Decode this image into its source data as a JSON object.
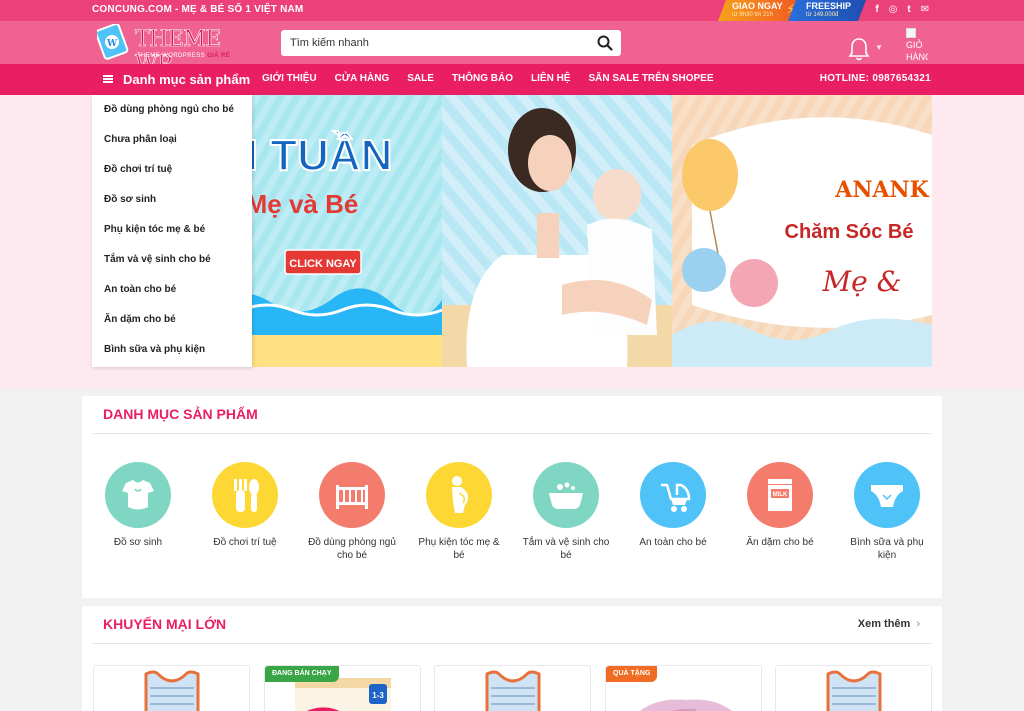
{
  "topbar": {
    "tagline": "CONCUNG.COM - MẸ & BÉ SỐ 1 VIỆT NAM",
    "promos": [
      {
        "title": "GIAO NGAY",
        "sub": "từ 8h30 tới 21h"
      },
      {
        "title": "FREESHIP",
        "sub": "từ 149.000đ"
      }
    ],
    "social": [
      {
        "icon": "facebook-icon",
        "glyph": "f"
      },
      {
        "icon": "instagram-icon",
        "glyph": "◎"
      },
      {
        "icon": "twitter-icon",
        "glyph": "t"
      },
      {
        "icon": "mail-icon",
        "glyph": "✉"
      }
    ]
  },
  "header": {
    "logo_text": "THEME WP",
    "logo_sub_a": "THEME WORDPRESS ",
    "logo_sub_b": "GIÁ RẺ",
    "search_placeholder": "Tìm kiếm nhanh",
    "cart_label": "GIỎ HÀNG"
  },
  "nav": {
    "menu_label": "Danh mục sản phẩm",
    "links": [
      "GIỚI THIỆU",
      "CỬA HÀNG",
      "SALE",
      "THÔNG BÁO",
      "LIÊN HỆ",
      "SĂN SALE TRÊN SHOPEE"
    ],
    "hotline": "HOTLINE: 0987654321"
  },
  "category_menu": [
    "Đồ dùng phòng ngủ cho bé",
    "Chưa phân loại",
    "Đồ chơi trí tuệ",
    "Đồ sơ sinh",
    "Phụ kiện tóc mẹ & bé",
    "Tắm và vệ sinh cho bé",
    "An toàn cho bé",
    "Ăn dặm cho bé",
    "Bình sữa và phụ kiện"
  ],
  "banner": {
    "left_title": "ỐI TUẦN",
    "left_sub": "Mẹ và Bé",
    "cta": "CLICK NGAY",
    "right_title": "ANANK",
    "right_sub": "Chăm Sóc Bé",
    "right_sub2": "Mẹ & "
  },
  "section_categories": {
    "title": "DANH MỤC SẢN PHẨM",
    "items": [
      {
        "label": "Đồ sơ sinh",
        "icon": "onesie-icon",
        "color": "#7fd6c2"
      },
      {
        "label": "Đồ chơi trí tuệ",
        "icon": "utensils-icon",
        "color": "#fdd835"
      },
      {
        "label": "Đồ dùng phòng ngủ cho bé",
        "icon": "crib-icon",
        "color": "#f47c6c"
      },
      {
        "label": "Phụ kiện tóc mẹ & bé",
        "icon": "pregnant-icon",
        "color": "#fdd835"
      },
      {
        "label": "Tắm và vệ sinh cho bé",
        "icon": "bathtub-icon",
        "color": "#7fd6c2"
      },
      {
        "label": "An toàn cho bé",
        "icon": "stroller-icon",
        "color": "#4fc3f7"
      },
      {
        "label": "Ăn dặm cho bé",
        "icon": "milk-icon",
        "color": "#f47c6c"
      },
      {
        "label": "Bình sữa và phụ kiện",
        "icon": "diaper-icon",
        "color": "#4fc3f7"
      }
    ]
  },
  "section_promo": {
    "title": "KHUYẾN MẠI LỚN",
    "more": "Xem thêm",
    "more_arrow": "›",
    "products": [
      {
        "badge": "",
        "image": "tank-top"
      },
      {
        "badge": "ĐANG BÁN CHẠY",
        "badge_color": "green",
        "image": "milk-can"
      },
      {
        "badge": "",
        "image": "tank-top"
      },
      {
        "badge": "QUÀ TẶNG",
        "badge_color": "orange",
        "image": "pink-cloth"
      },
      {
        "badge": "",
        "image": "tank-top"
      }
    ]
  },
  "colors": {
    "brand_pink": "#e91e63",
    "header_pink": "#f06292",
    "topbar_pink": "#ec407a"
  }
}
